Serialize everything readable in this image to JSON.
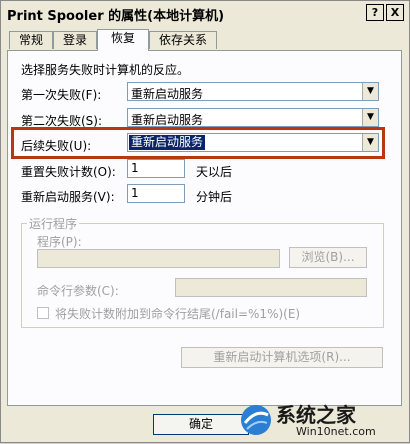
{
  "window": {
    "title": "Print Spooler 的属性(本地计算机)",
    "help_btn": "?",
    "close_btn": "X"
  },
  "tabs": [
    {
      "label": "常规",
      "active": false
    },
    {
      "label": "登录",
      "active": false
    },
    {
      "label": "恢复",
      "active": true
    },
    {
      "label": "依存关系",
      "active": false
    }
  ],
  "recovery": {
    "intro": "选择服务失败时计算机的反应。",
    "first_failure": {
      "label": "第一次失败(F):",
      "value": "重新启动服务"
    },
    "second_failure": {
      "label": "第二次失败(S):",
      "value": "重新启动服务"
    },
    "subsequent_failure": {
      "label": "后续失败(U):",
      "value": "重新启动服务"
    },
    "reset_count": {
      "label": "重置失败计数(O):",
      "value": "1",
      "suffix": "天以后"
    },
    "restart_service": {
      "label": "重新启动服务(V):",
      "value": "1",
      "suffix": "分钟后"
    }
  },
  "run_program": {
    "group_title": "运行程序",
    "program_label": "程序(P):",
    "program_value": "",
    "browse_label": "浏览(B)...",
    "cmdline_label": "命令行参数(C):",
    "cmdline_value": "",
    "append_label": "将失败计数附加到命令行结尾(/fail=%1%)(E)"
  },
  "restart_options_label": "重新启动计算机选项(R)...",
  "ok_label": "确定",
  "watermark": {
    "line1": "系统之家",
    "line2": "Win10net.com"
  },
  "colors": {
    "selection": "#0a246a",
    "highlight_border": "#b8380e"
  }
}
